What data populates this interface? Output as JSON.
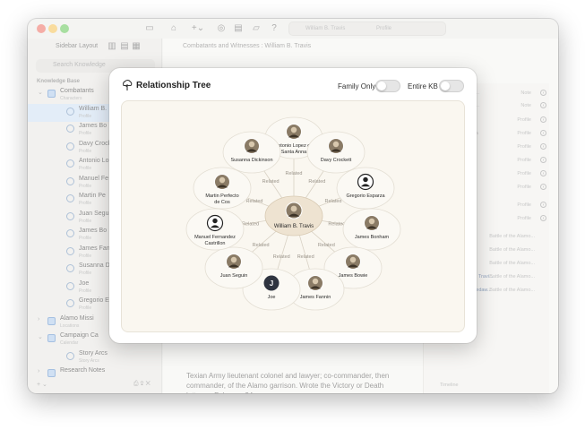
{
  "sidebar": {
    "title": "Sidebar Layout",
    "search_placeholder": "Search Knowledge",
    "section": "Knowledge Base",
    "items": [
      {
        "name": "Combatants",
        "sub": "Characters"
      },
      {
        "name": "William B.",
        "sub": "Profile"
      },
      {
        "name": "James Bo",
        "sub": "Profile"
      },
      {
        "name": "Davy Crock",
        "sub": "Profile"
      },
      {
        "name": "Antonio Lo",
        "sub": "Profile"
      },
      {
        "name": "Manuel Fe",
        "sub": "Profile"
      },
      {
        "name": "Martin Pe",
        "sub": "Profile"
      },
      {
        "name": "Juan Segui",
        "sub": "Profile"
      },
      {
        "name": "James Bo",
        "sub": "Profile"
      },
      {
        "name": "James Fan",
        "sub": "Profile"
      },
      {
        "name": "Susanna D",
        "sub": "Profile"
      },
      {
        "name": "Joe",
        "sub": "Profile"
      },
      {
        "name": "Gregorio E",
        "sub": "Profile"
      },
      {
        "name": "Alamo Missi",
        "sub": "Locations"
      },
      {
        "name": "Campaign Ca",
        "sub": "Calendar"
      },
      {
        "name": "Story Arcs",
        "sub": "Story Arcs"
      },
      {
        "name": "Research Notes",
        "sub": ""
      }
    ]
  },
  "toolbar": {
    "search_text": "William B. Travis",
    "search_kind": "Profile"
  },
  "main": {
    "breadcrumb": "Combatants and Witnesses : William B. Travis",
    "description": "Texian Army lieutenant colonel and lawyer; co-commander, then commander, of the Alamo garrison. Wrote the Victory or Death letter on February 24."
  },
  "right_panel": {
    "rows": [
      {
        "text": "pedia Ex...",
        "tag": "Note"
      },
      {
        "text": "-Referen...",
        "tag": "Note"
      },
      {
        "text": "",
        "tag": "Profile"
      },
      {
        "text": "anta Anna",
        "tag": "Profile"
      },
      {
        "text": "",
        "tag": "Profile"
      },
      {
        "text": "",
        "tag": "Profile"
      },
      {
        "text": "",
        "tag": "Profile"
      },
      {
        "text": "",
        "tag": "Profile"
      },
      {
        "text": "",
        "tag": "Profile"
      },
      {
        "text": "",
        "tag": "Profile"
      },
      {
        "text": "",
        "tag": "Battle of the Alamo..."
      },
      {
        "text": "",
        "tag": "Battle of the Alamo..."
      },
      {
        "text": "",
        "tag": "Battle of the Alamo..."
      },
      {
        "text": "Neill Leaves; Travi...",
        "tag": "Battle of the Alamo..."
      },
      {
        "text": "March 6 - Predaw...",
        "tag": "Battle of the Alamo..."
      }
    ],
    "footer": "Timeline"
  },
  "modal": {
    "title": "Relationship Tree",
    "family_only_label": "Family Only",
    "entire_kb_label": "Entire KB",
    "family_only": false,
    "entire_kb": false,
    "center": {
      "name": "William B. Travis"
    },
    "edge_label": "Related",
    "nodes": [
      {
        "name": "Antonio Lopez de Santa Anna",
        "lines": [
          "Antonio Lopez de",
          "Santa Anna"
        ],
        "avatar": "photo"
      },
      {
        "name": "Davy Crockett",
        "lines": [
          "Davy Crockett"
        ],
        "avatar": "photo"
      },
      {
        "name": "Gregorio Esparza",
        "lines": [
          "Gregorio Esparza"
        ],
        "avatar": "placeholder"
      },
      {
        "name": "James Bonham",
        "lines": [
          "James Bonham"
        ],
        "avatar": "photo"
      },
      {
        "name": "James Bowie",
        "lines": [
          "James Bowie"
        ],
        "avatar": "photo"
      },
      {
        "name": "James Fannin",
        "lines": [
          "James Fannin"
        ],
        "avatar": "photo"
      },
      {
        "name": "Joe",
        "lines": [
          "Joe"
        ],
        "avatar": "initial",
        "initial": "J"
      },
      {
        "name": "Juan Seguin",
        "lines": [
          "Juan Seguin"
        ],
        "avatar": "photo"
      },
      {
        "name": "Manuel Fernandez Castrillon",
        "lines": [
          "Manuel Fernandez",
          "Castrillon"
        ],
        "avatar": "placeholder"
      },
      {
        "name": "Martin Perfecto de Cos",
        "lines": [
          "Martin Perfecto",
          "de Cos"
        ],
        "avatar": "photo"
      },
      {
        "name": "Susanna Dickinson",
        "lines": [
          "Susanna Dickinson"
        ],
        "avatar": "photo"
      }
    ]
  }
}
